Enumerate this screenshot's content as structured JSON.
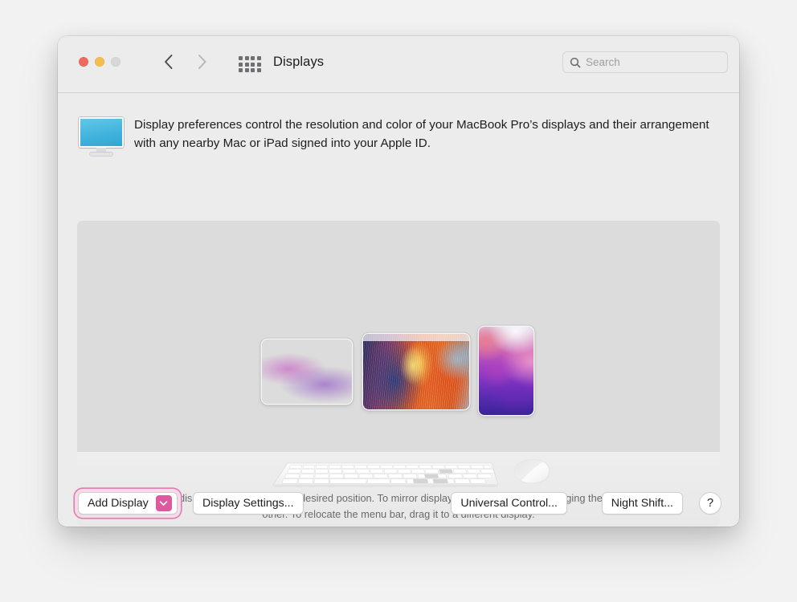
{
  "window": {
    "title": "Displays",
    "traffic_lights": [
      "close",
      "minimize",
      "zoom"
    ]
  },
  "toolbar": {
    "back_icon": "chevron-left-icon",
    "forward_icon": "chevron-right-icon",
    "grid_icon": "grid-icon",
    "search": {
      "placeholder": "Search",
      "icon": "search-icon",
      "value": ""
    }
  },
  "description": {
    "icon": "display-monitor-icon",
    "text": "Display preferences control the resolution and color of your MacBook Pro’s displays and their arrangement with any nearby Mac or iPad signed into your Apple ID."
  },
  "arrangement": {
    "hint": "To rearrange displays, drag them to the desired position. To mirror displays, hold Option while dragging them on top of each other. To relocate the menu bar, drag it to a different display.",
    "displays": [
      {
        "name": "display-thumbnail-left",
        "orientation": "landscape",
        "wallpaper": "monterey",
        "has_menu_bar": false
      },
      {
        "name": "display-thumbnail-main",
        "orientation": "landscape",
        "wallpaper": "abstract",
        "has_menu_bar": true
      },
      {
        "name": "display-thumbnail-right",
        "orientation": "portrait",
        "wallpaper": "monterey",
        "has_menu_bar": false
      }
    ],
    "peripherals": [
      "keyboard-graphic",
      "mouse-graphic"
    ]
  },
  "buttons": {
    "add_display": {
      "label": "Add Display",
      "badge_icon": "chevron-down-icon",
      "highlighted": true
    },
    "display_settings": "Display Settings...",
    "universal_control": "Universal Control...",
    "night_shift": "Night Shift...",
    "help": "?"
  },
  "colors": {
    "highlight_ring": "#e57ab2",
    "highlight_fill": "#f6dce9",
    "badge": "#dd5a9e",
    "traffic_close": "#ec6a5e",
    "traffic_min": "#f4bd4f",
    "traffic_zoom": "#d8d8d8",
    "window_bg": "#ececec",
    "canvas_bg": "#dcdcdc"
  }
}
